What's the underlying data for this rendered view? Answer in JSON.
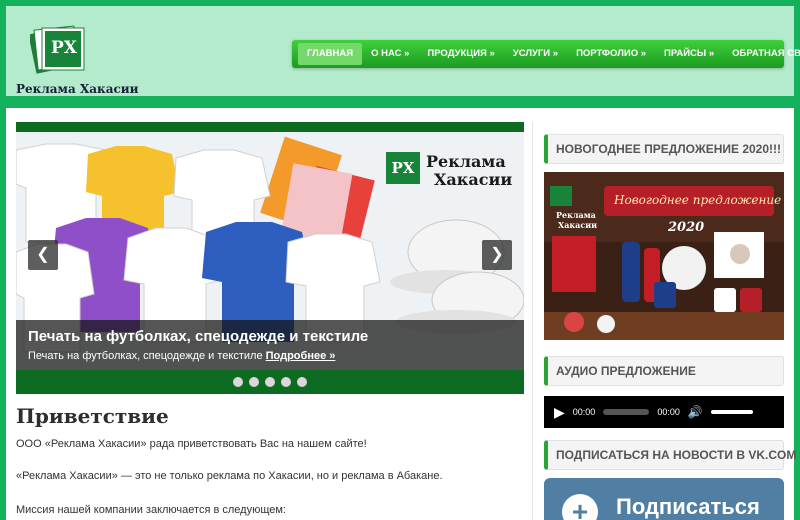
{
  "site": {
    "logo_monogram": "РХ",
    "name": "Реклама Хакасии"
  },
  "nav": {
    "items": [
      {
        "label": "Главная",
        "active": true
      },
      {
        "label": "О нас »",
        "active": false
      },
      {
        "label": "Продукция »",
        "active": false
      },
      {
        "label": "Услуги »",
        "active": false
      },
      {
        "label": "Портфолио »",
        "active": false
      },
      {
        "label": "Прайсы »",
        "active": false
      },
      {
        "label": "Обратная связь »",
        "active": false
      }
    ]
  },
  "slider": {
    "banner_monogram": "РХ",
    "banner_line1": "Реклама",
    "banner_line2": "Хакасии",
    "caption_title": "Печать на футболках, спецодежде и текстиле",
    "caption_text": "Печать на футболках, спецодежде и текстиле",
    "caption_link": "Подробнее »",
    "prev_icon": "chevron-left-icon",
    "next_icon": "chevron-right-icon",
    "dots_count": 5,
    "active_dot": 0
  },
  "main": {
    "heading": "Приветствие",
    "paragraphs": [
      "ООО «Реклама Хакасии» рада приветствовать Вас на нашем сайте!",
      "«Реклама Хакасии» — это не только реклама по Хакасии, но и реклама в Абакане.",
      "Миссия нашей компании заключается в следующем:"
    ]
  },
  "sidebar": {
    "promo_title": "Новогоднее предложение 2020!!!",
    "promo_banner_text": "Новогоднее предложение",
    "promo_banner_year": "2020",
    "promo_logo_line1": "Реклама",
    "promo_logo_line2": "Хакасии",
    "audio_title": "Аудио предложение",
    "audio_time_current": "00:00",
    "audio_time_total": "00:00",
    "vk_title": "Подписаться на новости в VK.com",
    "vk_button_label": "Подписаться",
    "vk_plus": "+"
  },
  "colors": {
    "brand_green": "#13b25a",
    "header_bg": "#b4ebcc",
    "slider_bar": "#0c6a21",
    "vk_blue": "#517fa4"
  }
}
